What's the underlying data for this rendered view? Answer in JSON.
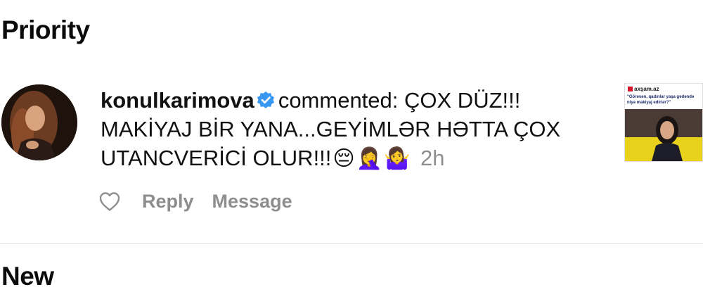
{
  "sections": {
    "priority_title": "Priority",
    "new_title": "New"
  },
  "notification": {
    "username": "konulkarimova",
    "verified": true,
    "action_text": "commented:",
    "comment_text": "ÇOX DÜZ!!! MAKİYAJ BİR YANA...GEYİMLƏR HƏTTA ÇOX UTANCVERİCİ OLUR!!!",
    "emojis": [
      "😔",
      "🤦‍♀️",
      "🤷‍♀️"
    ],
    "time_ago": "2h",
    "actions": {
      "like_icon": "heart-outline-icon",
      "reply_label": "Reply",
      "message_label": "Message"
    },
    "post_thumbnail": {
      "site_name": "axşam.az",
      "caption": "\"Görəsən, qadınlar yaşa gedəndə niyə makiyaj edirlər?\""
    }
  },
  "colors": {
    "verified_badge": "#3897f0",
    "secondary_text": "#8e8e8e",
    "divider": "#e3e3e3"
  }
}
